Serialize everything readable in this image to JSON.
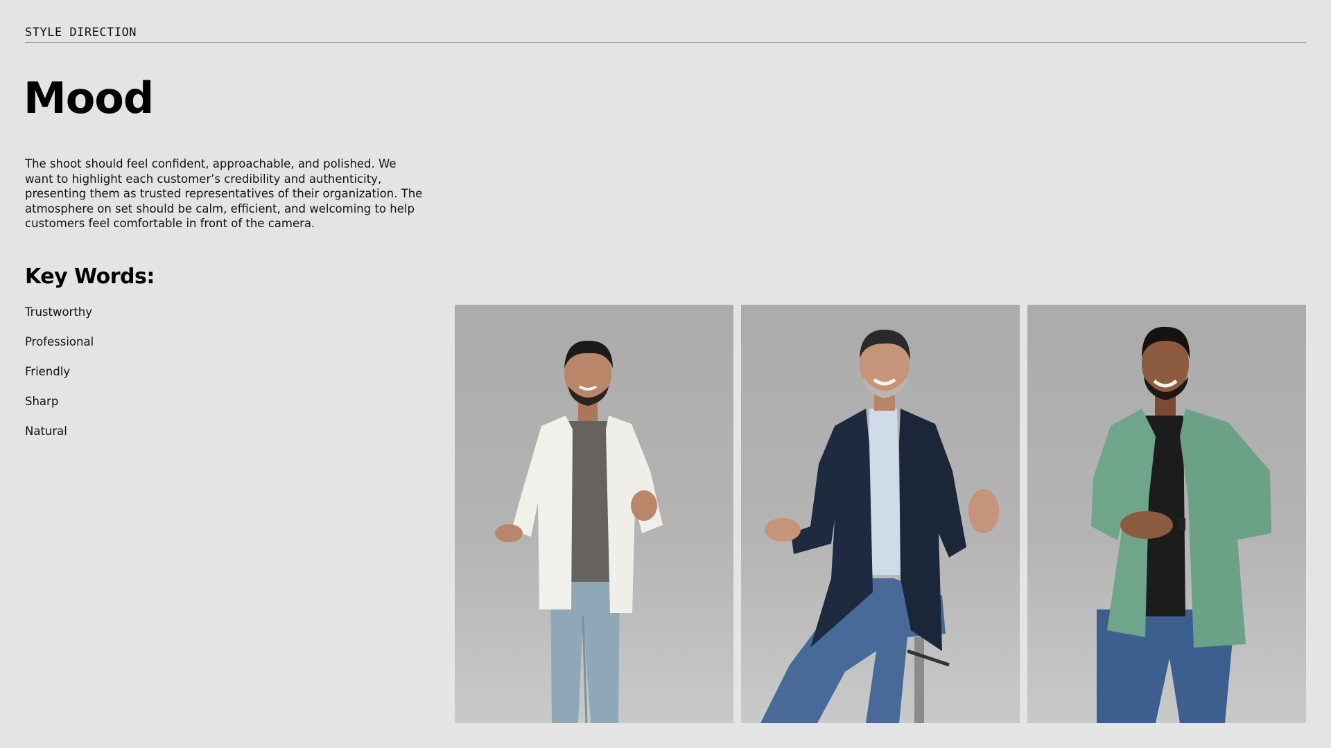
{
  "header": {
    "section_label": "STYLE DIRECTION"
  },
  "main": {
    "title": "Mood",
    "description": "The shoot should feel confident, approachable, and polished. We want to highlight each customer’s credibility and authenticity, presenting them as trusted representatives of their organization. The atmosphere on set should be calm, efficient, and welcoming to help customers feel comfortable in front of the camera.",
    "keywords": {
      "heading": "Key Words:",
      "items": [
        "Trustworthy",
        "Professional",
        "Friendly",
        "Sharp",
        "Natural"
      ]
    }
  },
  "colors": {
    "background": "#e4e4e4",
    "photo_backdrop": "#b1b1b1",
    "rule": "#9b9b9b"
  }
}
